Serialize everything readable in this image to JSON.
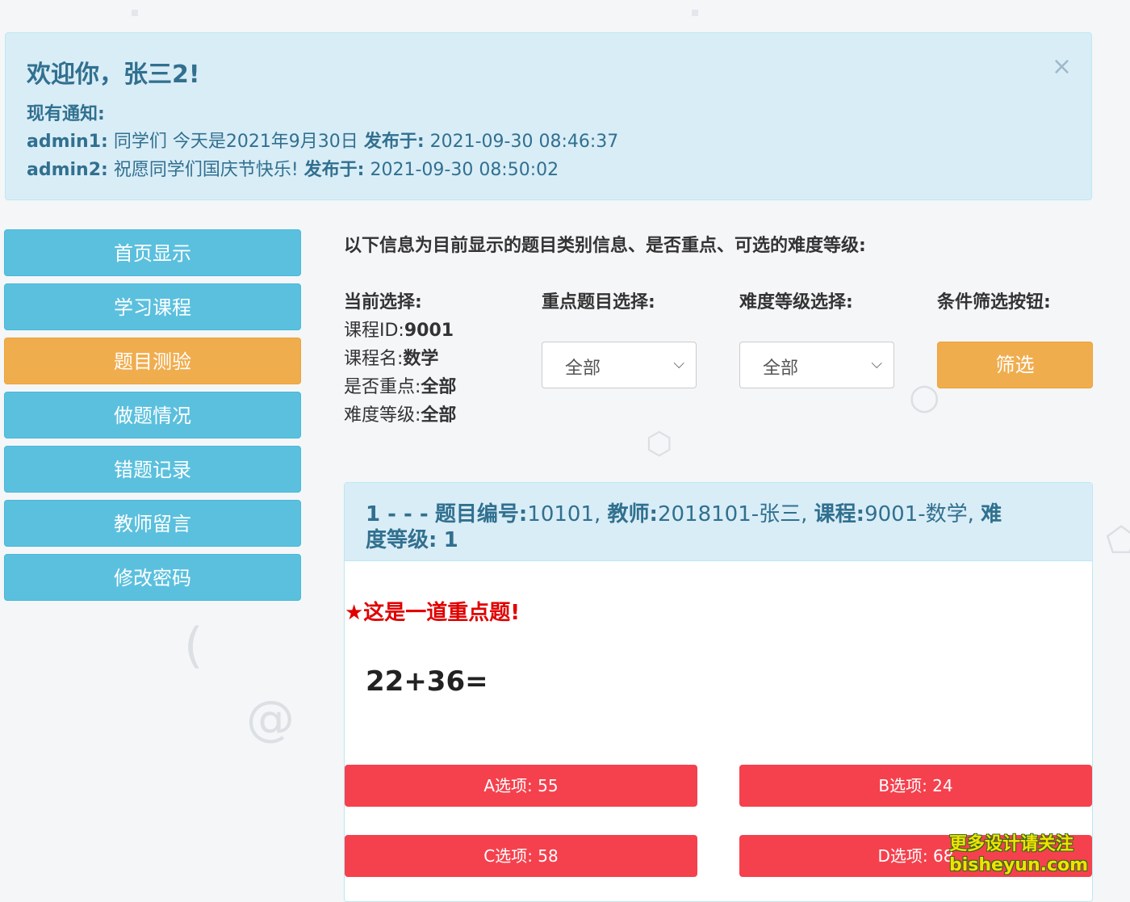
{
  "alert": {
    "title": "欢迎你，张三2!",
    "close_icon": "×",
    "notices_label": "现有通知:",
    "notices": [
      {
        "author": "admin1:",
        "text": "同学们 今天是2021年9月30日",
        "pub_label": "发布于:",
        "time": "2021-09-30 08:46:37"
      },
      {
        "author": "admin2:",
        "text": "祝愿同学们国庆节快乐!",
        "pub_label": "发布于:",
        "time": "2021-09-30 08:50:02"
      }
    ]
  },
  "sidebar": {
    "items": [
      {
        "label": "首页显示"
      },
      {
        "label": "学习课程"
      },
      {
        "label": "题目测验"
      },
      {
        "label": "做题情况"
      },
      {
        "label": "错题记录"
      },
      {
        "label": "教师留言"
      },
      {
        "label": "修改密码"
      }
    ],
    "active_index": 2
  },
  "filter": {
    "heading": "以下信息为目前显示的题目类别信息、是否重点、可选的难度等级:",
    "current_heading": "当前选择:",
    "course_id_label": "课程ID:",
    "course_id": "9001",
    "course_name_label": "课程名:",
    "course_name": "数学",
    "key_label": "是否重点:",
    "key_value": "全部",
    "level_label": "难度等级:",
    "level_value": "全部",
    "key_select_heading": "重点题目选择:",
    "key_select_value": "全部",
    "level_select_heading": "难度等级选择:",
    "level_select_value": "全部",
    "button_heading": "条件筛选按钮:",
    "button_label": "筛选"
  },
  "question": {
    "head_line1_index": "1 - - -",
    "id_label": "题目编号:",
    "id": "10101,",
    "teacher_label": "教师:",
    "teacher": "2018101-张三,",
    "course_label": "课程:",
    "course": "9001-数学,",
    "level_label_a": "难",
    "level_label_b": "度等级:",
    "level": "1",
    "key_note": "★这是一道重点题!",
    "text": "22+36=",
    "options": [
      {
        "label": "A选项: 55"
      },
      {
        "label": "B选项: 24"
      },
      {
        "label": "C选项: 58"
      },
      {
        "label": "D选项: 68"
      }
    ]
  },
  "watermark": {
    "line1": "更多设计请关注",
    "line2": "bisheyun.com"
  },
  "colors": {
    "info_bg": "#d9edf7",
    "info_text": "#31708f",
    "nav_btn": "#5bc0de",
    "nav_active": "#f0ad4e",
    "option_btn": "#f5414d",
    "key_note": "#e00000"
  }
}
